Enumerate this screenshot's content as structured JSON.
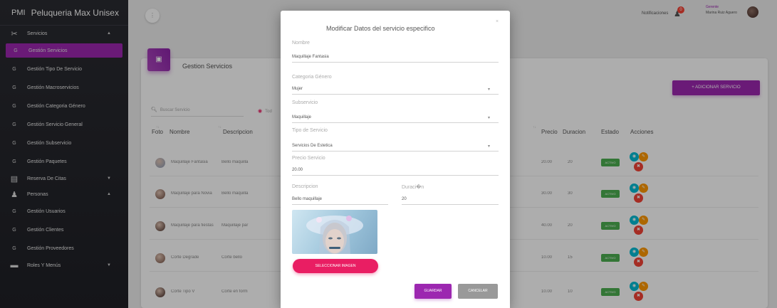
{
  "sidebar": {
    "brand_mini": "PMI",
    "brand_name": "Peluqueria Max Unisex",
    "section": {
      "label": "Servicios",
      "icon": "scissors-icon"
    },
    "items": [
      {
        "icon_text": "G",
        "label": "Gestión Servicios"
      },
      {
        "icon_text": "G",
        "label": "Gestión Tipo De Servicio"
      },
      {
        "icon_text": "G",
        "label": "Gestión Macroservicios"
      },
      {
        "icon_text": "G",
        "label": "Gestión Categoria Género"
      },
      {
        "icon_text": "G",
        "label": "Gestión Servicio General"
      },
      {
        "icon_text": "G",
        "label": "Gestión Subservicio"
      },
      {
        "icon_text": "G",
        "label": "Gestión Paquetes"
      },
      {
        "icon_text": "▤",
        "label": "Reserva De Citas"
      },
      {
        "icon_text": "♟",
        "label": "Personas"
      },
      {
        "icon_text": "G",
        "label": "Gestión Usuarios"
      },
      {
        "icon_text": "G",
        "label": "Gestión Clientes"
      },
      {
        "icon_text": "G",
        "label": "Gestión Proveedores"
      },
      {
        "icon_text": "▬",
        "label": "Roles Y Menús"
      }
    ]
  },
  "topbar": {
    "menu_icon": "more-vert-icon",
    "menu_glyph": "⋮",
    "notifications_label": "Notificaciones",
    "notifications_count": "0",
    "user_role": "Gerente",
    "user_name": "Marina Ruiz Aguero"
  },
  "page": {
    "card_icon_glyph": "▣",
    "title": "Gestion Servicios",
    "add_button": "+ ADICIONAR SERVICIO",
    "search_placeholder": "Buscar Servicio",
    "filter_label": "Tod",
    "columns": [
      "Foto",
      "Nombre",
      "Descripcion",
      "Precio",
      "Duracion",
      "Estado",
      "Acciones"
    ],
    "rows": [
      {
        "nombre": "Maquillaje Fantasia",
        "descripcion": "Bello maquilla",
        "precio": "20.00",
        "duracion": "20",
        "estado": "ACTIVO",
        "photo_color": "#8a9bb5"
      },
      {
        "nombre": "Maquillaje para Novia",
        "descripcion": "Bello maquilla",
        "precio": "30.00",
        "duracion": "30",
        "estado": "ACTIVO",
        "photo_color": "#6d4c41"
      },
      {
        "nombre": "Maquillaje para fiestas",
        "descripcion": "Maquillaje par",
        "precio": "40.00",
        "duracion": "20",
        "estado": "ACTIVO",
        "photo_color": "#4e342e"
      },
      {
        "nombre": "Corte Degrade",
        "descripcion": "Corte bello",
        "precio": "10.00",
        "duracion": "15",
        "estado": "ACTIVO",
        "photo_color": "#795548"
      },
      {
        "nombre": "Corte Tipo V",
        "descripcion": "Corte en form",
        "precio": "10.00",
        "duracion": "10",
        "estado": "ACTIVO",
        "photo_color": "#3e2723"
      }
    ]
  },
  "modal": {
    "title": "Modificar Datos del servicio especifico",
    "close_glyph": "×",
    "nombre_label": "Nombre",
    "nombre_value": "Maquillaje Fantasia",
    "categoria_label": "Categoria Género",
    "categoria_value": "Mujer",
    "subservicio_label": "Subservicio",
    "subservicio_value": "Maquillaje",
    "tipo_label": "Tipo de Servicio",
    "tipo_value": "Servicios De Estetica",
    "precio_label": "Precio Servicio",
    "precio_value": "20.00",
    "descripcion_label": "Descripcion",
    "descripcion_value": "Bello maquillaje",
    "duracion_label": "Duraci�n",
    "duracion_value": "20",
    "select_image_button": "SELECCIONAR IMAGEN",
    "save_button": "GUARDAR",
    "cancel_button": "CANCELAR"
  },
  "colors": {
    "primary": "#9c27b0",
    "accent": "#e91e63",
    "success": "#4caf50",
    "info": "#00bcd4",
    "warning": "#ff9800",
    "danger": "#f44336"
  }
}
